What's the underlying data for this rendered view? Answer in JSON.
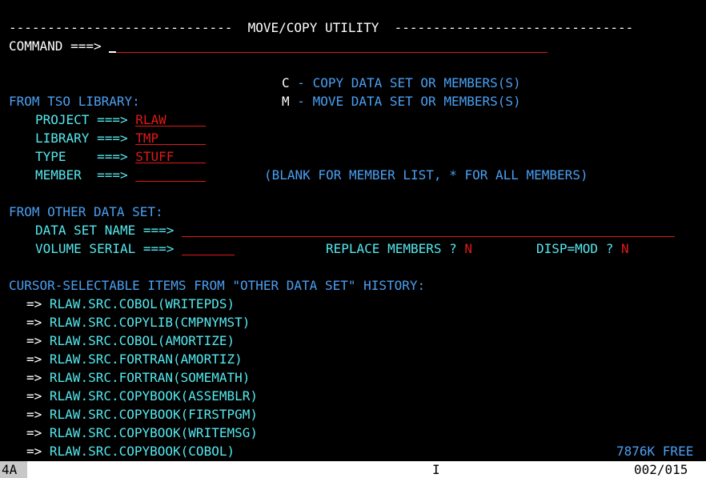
{
  "header": {
    "dashes_left": "-----------------------------",
    "title": "MOVE/COPY UTILITY",
    "dashes_right": "-------------------------------"
  },
  "command": {
    "label": "COMMAND ===>",
    "value": ""
  },
  "options": [
    {
      "key": "C",
      "sep": "-",
      "desc": "COPY DATA SET OR MEMBERS(S)"
    },
    {
      "key": "M",
      "sep": "-",
      "desc": "MOVE DATA SET OR MEMBERS(S)"
    }
  ],
  "tso_library": {
    "heading": "FROM TSO LIBRARY:",
    "project_label": "PROJECT ===>",
    "project_value": "RLAW",
    "library_label": "LIBRARY ===>",
    "library_value": "TMP",
    "type_label": "TYPE    ===>",
    "type_value": "STUFF",
    "member_label": "MEMBER  ===>",
    "member_value": "",
    "member_hint": "(BLANK FOR MEMBER LIST, * FOR ALL MEMBERS)"
  },
  "other_data_set": {
    "heading": "FROM OTHER DATA SET:",
    "dsn_label": "DATA SET NAME ===>",
    "dsn_value": "",
    "volser_label": "VOLUME SERIAL ===>",
    "volser_value": "",
    "replace_label": "REPLACE MEMBERS ?",
    "replace_value": "N",
    "disp_label": "DISP=MOD ?",
    "disp_value": "N"
  },
  "history": {
    "heading": "CURSOR-SELECTABLE ITEMS FROM \"OTHER DATA SET\" HISTORY:",
    "arrow": "=>",
    "items": [
      "RLAW.SRC.COBOL(WRITEPDS)",
      "RLAW.SRC.COPYLIB(CMPNYMST)",
      "RLAW.SRC.COBOL(AMORTIZE)",
      "RLAW.SRC.FORTRAN(AMORTIZ)",
      "RLAW.SRC.FORTRAN(SOMEMATH)",
      "RLAW.SRC.COPYBOOK(ASSEMBLR)",
      "RLAW.SRC.COPYBOOK(FIRSTPGM)",
      "RLAW.SRC.COPYBOOK(WRITEMSG)",
      "RLAW.SRC.COPYBOOK(COBOL)"
    ],
    "free_space": "7876K FREE"
  },
  "status_bar": {
    "session": "4A",
    "mode": "I",
    "position": "002/015"
  }
}
